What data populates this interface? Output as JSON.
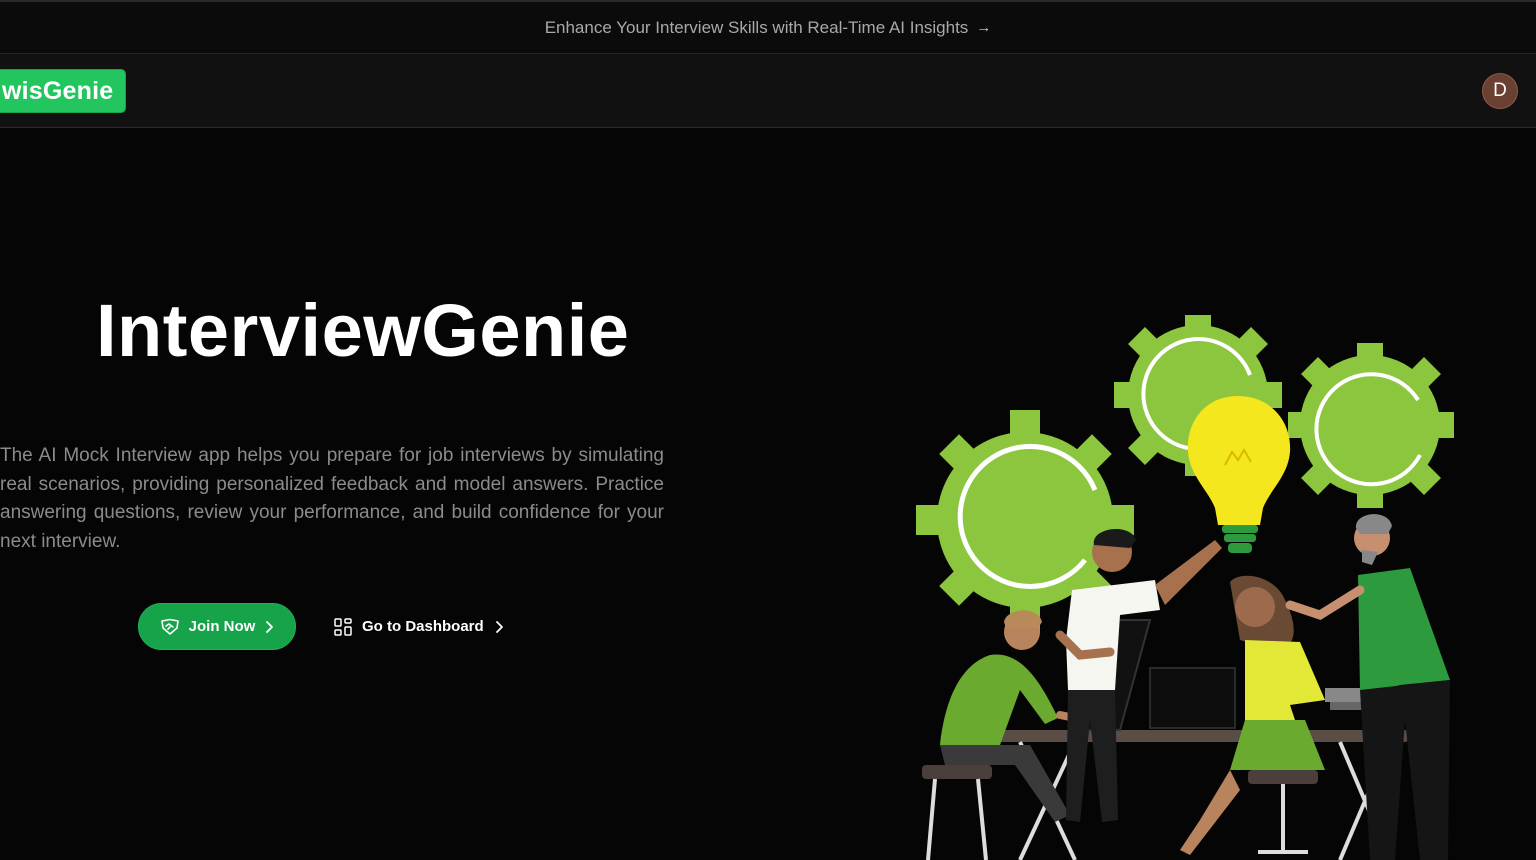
{
  "announcement": {
    "text": "Enhance Your Interview Skills with Real-Time AI Insights",
    "icon": "arrow-right-icon"
  },
  "navbar": {
    "logo_text": "wisGenie",
    "avatar_initial": "D"
  },
  "hero": {
    "title": "InterviewGenie",
    "description": "The AI Mock Interview app helps you prepare for job interviews by simulating real scenarios, providing personalized feedback and model answers. Practice answering questions, review your performance, and build confidence for your next interview.",
    "primary_button": {
      "label": "Join Now",
      "icon": "handshake-icon",
      "trailing_icon": "chevron-right-icon"
    },
    "secondary_button": {
      "label": "Go to Dashboard",
      "icon": "dashboard-grid-icon",
      "trailing_icon": "chevron-right-icon"
    }
  },
  "illustration": {
    "name": "team-brainstorm-illustration",
    "elements": [
      "gear-icon",
      "gear-icon",
      "gear-icon",
      "lightbulb-icon"
    ]
  },
  "colors": {
    "accent": "#22c55e",
    "button_green": "#16a34a",
    "gear_green": "#8cc63f",
    "bulb_yellow": "#f5e71d",
    "background": "#050505",
    "avatar": "#6a4032"
  }
}
